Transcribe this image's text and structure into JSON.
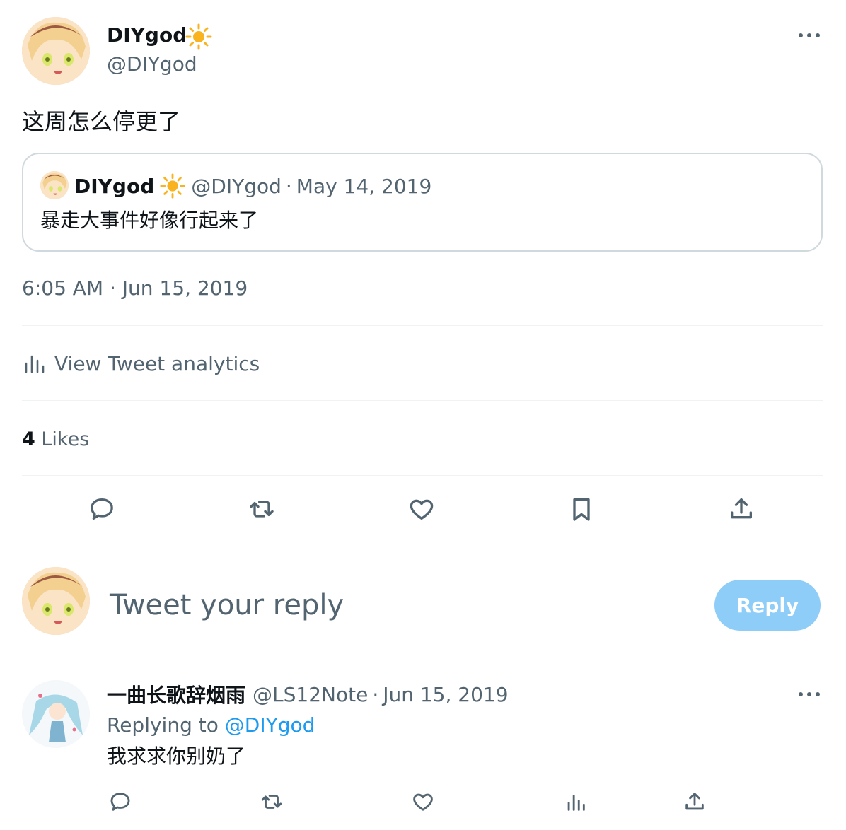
{
  "tweet": {
    "author_name": "DIYgod",
    "author_handle": "@DIYgod",
    "author_emoji": "☀️",
    "text": "这周怎么停更了",
    "timestamp": "6:05 AM · Jun 15, 2019"
  },
  "quoted": {
    "author_name": "DIYgod",
    "author_handle": "@DIYgod",
    "date": "May 14, 2019",
    "text": "暴走大事件好像行起来了"
  },
  "analytics": {
    "label": "View Tweet analytics"
  },
  "stats": {
    "likes_count": "4",
    "likes_label": "Likes"
  },
  "actions": {
    "icons": [
      "reply-icon",
      "retweet-icon",
      "like-icon",
      "bookmark-icon",
      "share-icon"
    ]
  },
  "composer": {
    "placeholder": "Tweet your reply",
    "button_label": "Reply"
  },
  "reply": {
    "author_name": "一曲长歌辞烟雨",
    "author_handle": "@LS12Note",
    "date": "Jun 15, 2019",
    "replying_prefix": "Replying to",
    "replying_to": "@DIYgod",
    "text": "我求求你别奶了"
  },
  "colors": {
    "accent": "#1d9bf0",
    "reply_button_disabled": "#8ecdf8",
    "muted_text": "#536471",
    "divider": "#eff3f4"
  }
}
